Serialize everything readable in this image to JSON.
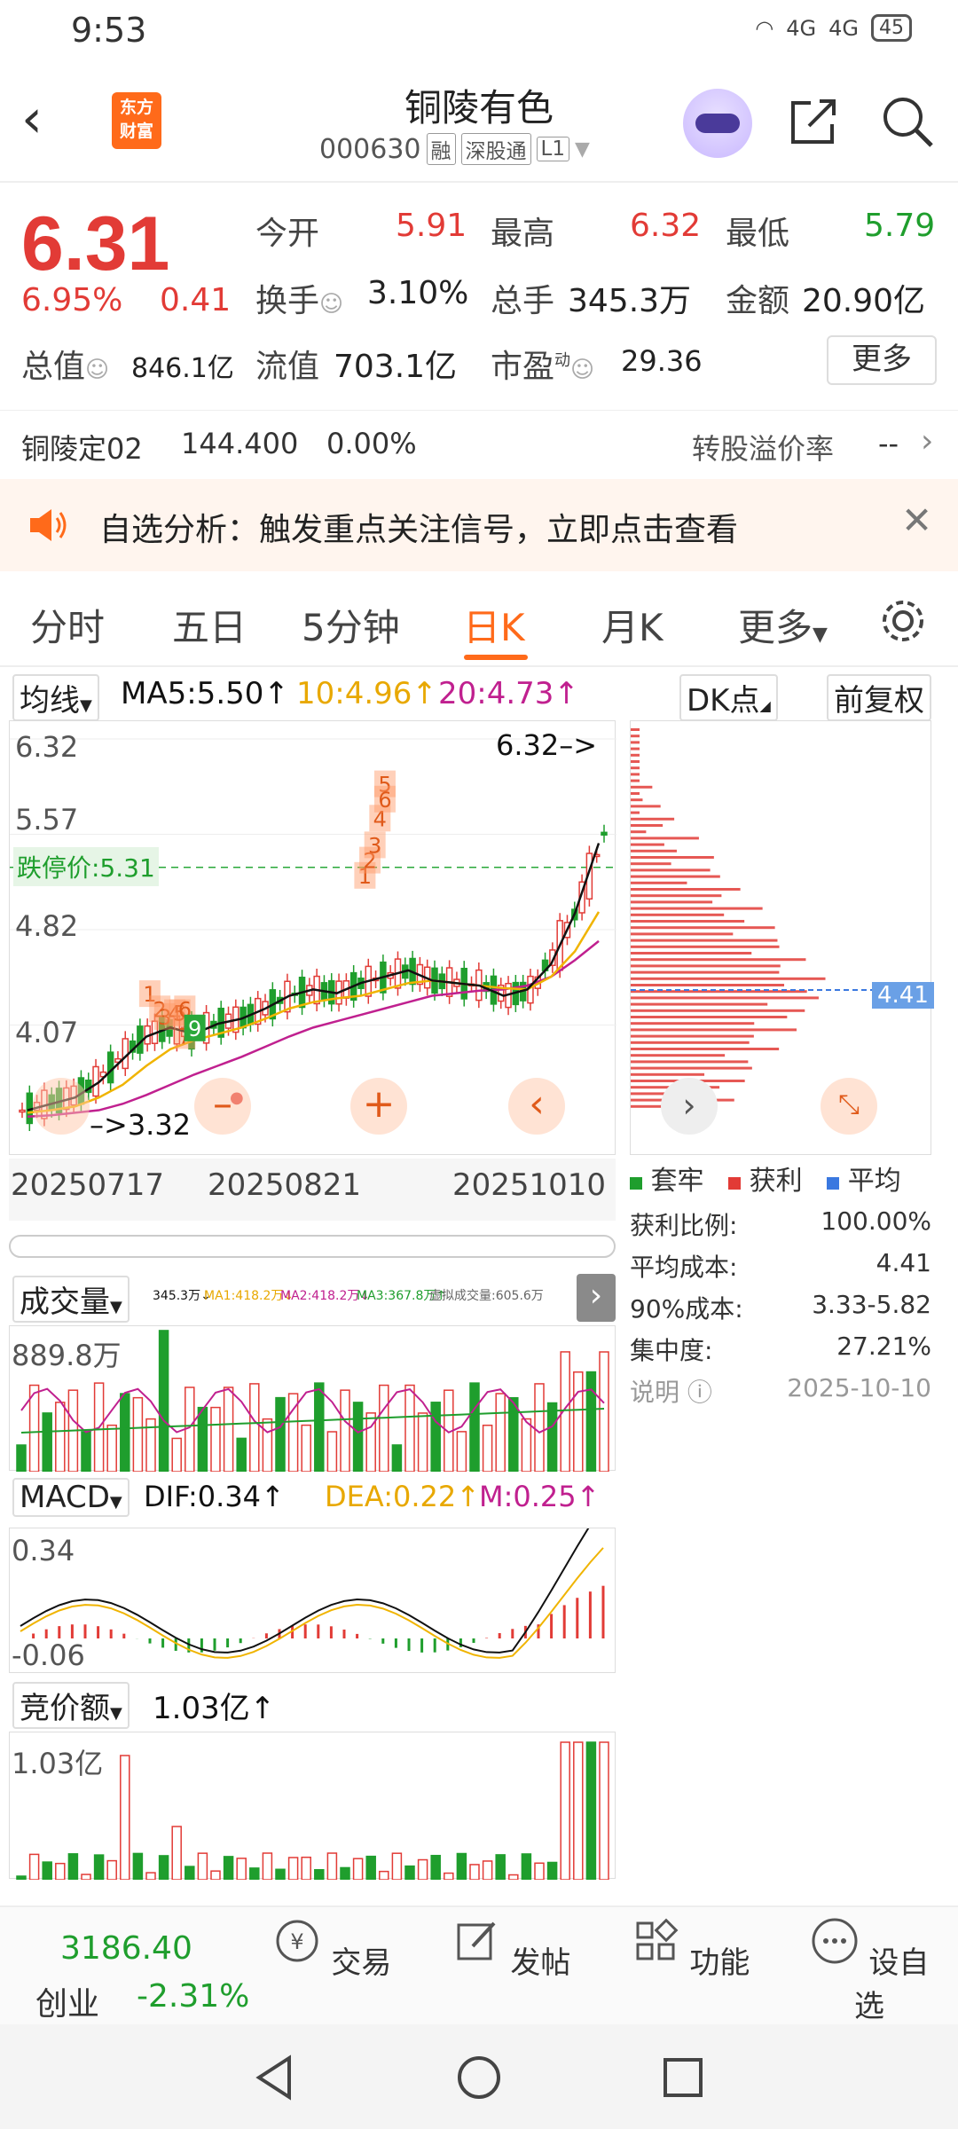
{
  "status": {
    "time": "9:53",
    "net1": "4G",
    "net2": "4G",
    "battery": "45"
  },
  "header": {
    "back": "‹",
    "logo": "东方财富",
    "name": "铜陵有色",
    "code": "000630",
    "tags": [
      "融",
      "深股通",
      "L1"
    ]
  },
  "quote": {
    "price": "6.31",
    "pct": "6.95%",
    "change": "0.41",
    "open_label": "今开",
    "open": "5.91",
    "high_label": "最高",
    "high": "6.32",
    "low_label": "最低",
    "low": "5.79",
    "turnover_label": "换手",
    "turnover": "3.10%",
    "volume_label": "总手",
    "volume": "345.3万",
    "amount_label": "金额",
    "amount": "20.90亿",
    "mcap_label": "总值",
    "mcap": "846.1亿",
    "float_label": "流值",
    "float": "703.1亿",
    "pe_label": "市盈",
    "pe_sup": "动",
    "pe": "29.36",
    "more": "更多"
  },
  "bond": {
    "name": "铜陵定02",
    "price": "144.400",
    "pct": "0.00%",
    "premium_label": "转股溢价率",
    "premium": "--"
  },
  "banner": {
    "text": "自选分析：触发重点关注信号，立即点击查看"
  },
  "tabs": [
    {
      "label": "分时"
    },
    {
      "label": "五日"
    },
    {
      "label": "5分钟"
    },
    {
      "label": "日K"
    },
    {
      "label": "月K"
    },
    {
      "label": "更多"
    }
  ],
  "ma": {
    "type": "均线",
    "ma5": "MA5:5.50↑",
    "ma10": "10:4.96↑",
    "ma20": "20:4.73↑",
    "dk": "DK点",
    "adjust": "前复权"
  },
  "colors": {
    "red": "#e23b36",
    "green": "#1f9e2d",
    "orange": "#ff6a1a",
    "ma5": "#111111",
    "ma10": "#f0b400",
    "ma20": "#c0208f",
    "blue": "#3a78e0"
  },
  "kchart": {
    "price_ticks": [
      "6.32",
      "5.57",
      "4.82",
      "4.07",
      "3.32"
    ],
    "limit_down_label": "跌停价:5.31",
    "high_marker": "6.32",
    "low_marker": "3.32",
    "dates": [
      "20250717",
      "20250821",
      "20251010"
    ],
    "signals": [
      "1",
      "2",
      "3",
      "4",
      "5",
      "6",
      "7",
      "9",
      "1",
      "2",
      "3",
      "4",
      "5",
      "6"
    ]
  },
  "chart_data": [
    {
      "type": "candlestick",
      "ylim": [
        3.32,
        6.32
      ],
      "x_ticks": [
        "20250717",
        "20250821",
        "20251010"
      ],
      "series": [
        {
          "name": "MA5",
          "values": [
            3.4,
            3.45,
            3.5,
            3.62,
            3.8,
            3.98,
            4.05,
            4.0,
            4.08,
            4.12,
            4.2,
            4.3,
            4.35,
            4.32,
            4.4,
            4.45,
            4.5,
            4.42,
            4.4,
            4.38,
            4.3,
            4.35,
            4.55,
            4.95,
            5.5
          ]
        },
        {
          "name": "10",
          "values": [
            3.38,
            3.4,
            3.43,
            3.5,
            3.6,
            3.75,
            3.88,
            3.95,
            4.0,
            4.05,
            4.12,
            4.2,
            4.25,
            4.28,
            4.3,
            4.35,
            4.4,
            4.42,
            4.4,
            4.38,
            4.36,
            4.35,
            4.45,
            4.65,
            4.96
          ]
        },
        {
          "name": "20",
          "values": [
            3.35,
            3.36,
            3.38,
            3.4,
            3.45,
            3.52,
            3.6,
            3.68,
            3.75,
            3.82,
            3.9,
            3.98,
            4.05,
            4.1,
            4.15,
            4.2,
            4.25,
            4.3,
            4.32,
            4.34,
            4.35,
            4.38,
            4.45,
            4.58,
            4.73
          ]
        }
      ]
    },
    {
      "type": "bar",
      "title": "成交量",
      "values_label": "889.8万",
      "ma_labels": [
        "345.3万↓",
        "MA1:418.2万↓",
        "MA2:418.2万↓",
        "MA3:367.8万↑",
        "虚拟成交量:605.6万"
      ]
    },
    {
      "type": "bar",
      "title": "MACD",
      "dif": "DIF:0.34↑",
      "dea": "DEA:0.22↑",
      "m": "M:0.25↑",
      "ticks": [
        "0.34",
        "-0.06"
      ]
    },
    {
      "type": "bar",
      "title": "竞价额",
      "value": "1.03亿↑",
      "tick": "1.03亿"
    }
  ],
  "chip": {
    "avg_label": "4.41",
    "legend": [
      "套牢",
      "获利",
      "平均"
    ],
    "rows": [
      {
        "k": "获利比例:",
        "v": "100.00%"
      },
      {
        "k": "平均成本:",
        "v": "4.41"
      },
      {
        "k": "90%成本:",
        "v": "3.33-5.82"
      },
      {
        "k": "集中度:",
        "v": "27.21%"
      },
      {
        "k": "说明",
        "v": "2025-10-10"
      }
    ]
  },
  "nav": {
    "index_value": "3186.40",
    "index_name": "创业",
    "index_pct": "-2.31%",
    "items": [
      "交易",
      "发帖",
      "功能",
      "设自选"
    ]
  }
}
